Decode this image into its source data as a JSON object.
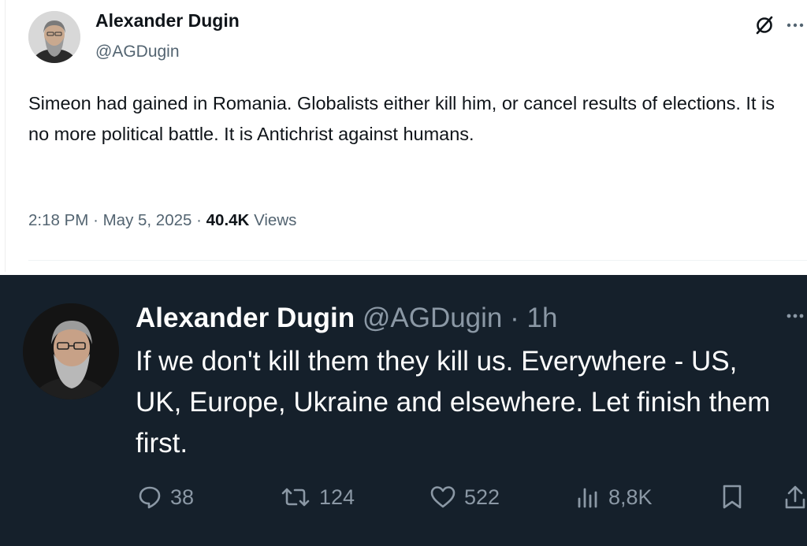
{
  "top_tweet": {
    "author_name": "Alexander Dugin",
    "author_handle": "@AGDugin",
    "text": "Simeon had gained in Romania. Globalists either kill him, or cancel results of elections. It is no more political battle. It is Antichrist against humans.",
    "time": "2:18 PM",
    "separator": "·",
    "date": "May 5, 2025",
    "views_count": "40.4K",
    "views_label": "Views",
    "more_icon": "ellipsis-icon",
    "grok_icon": "grok-icon"
  },
  "bottom_tweet": {
    "author_name": "Alexander Dugin",
    "author_handle": "@AGDugin",
    "separator": "·",
    "time_ago": "1h",
    "text": "If we don't kill them they kill us. Everywhere - US, UK, Europe, Ukraine and elsewhere.  Let finish them first.",
    "stats": {
      "replies": "38",
      "reposts": "124",
      "likes": "522",
      "views": "8,8K"
    },
    "colors": {
      "background": "#15202b",
      "text": "#ffffff",
      "muted": "#8b98a5"
    }
  }
}
